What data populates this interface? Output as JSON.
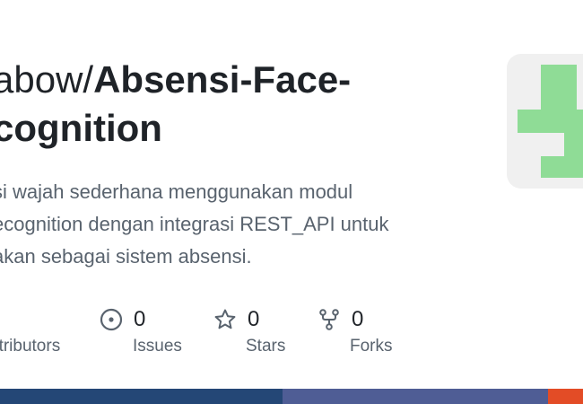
{
  "repo": {
    "owner_visible": "abow/",
    "name_line1": "Absensi-Face-",
    "name_line2": "cognition"
  },
  "description": {
    "line1": "si wajah sederhana menggunakan modul",
    "line2": "ecognition dengan integrasi REST_API untuk",
    "line3": "akan sebagai sistem absensi."
  },
  "stats": [
    {
      "label": "ntributors",
      "value": "",
      "icon": "people-icon"
    },
    {
      "label": "Issues",
      "value": "0",
      "icon": "issue-circle-icon"
    },
    {
      "label": "Stars",
      "value": "0",
      "icon": "star-icon"
    },
    {
      "label": "Forks",
      "value": "0",
      "icon": "fork-icon"
    }
  ],
  "avatar": {
    "icon": "identicon-avatar",
    "color": "#8fdc96",
    "background": "#f0f0f0"
  },
  "language_bar": [
    {
      "color": "#244776",
      "fraction": 0.485
    },
    {
      "color": "#4f5d95",
      "fraction": 0.455
    },
    {
      "color": "#e34c26",
      "fraction": 0.06
    }
  ]
}
